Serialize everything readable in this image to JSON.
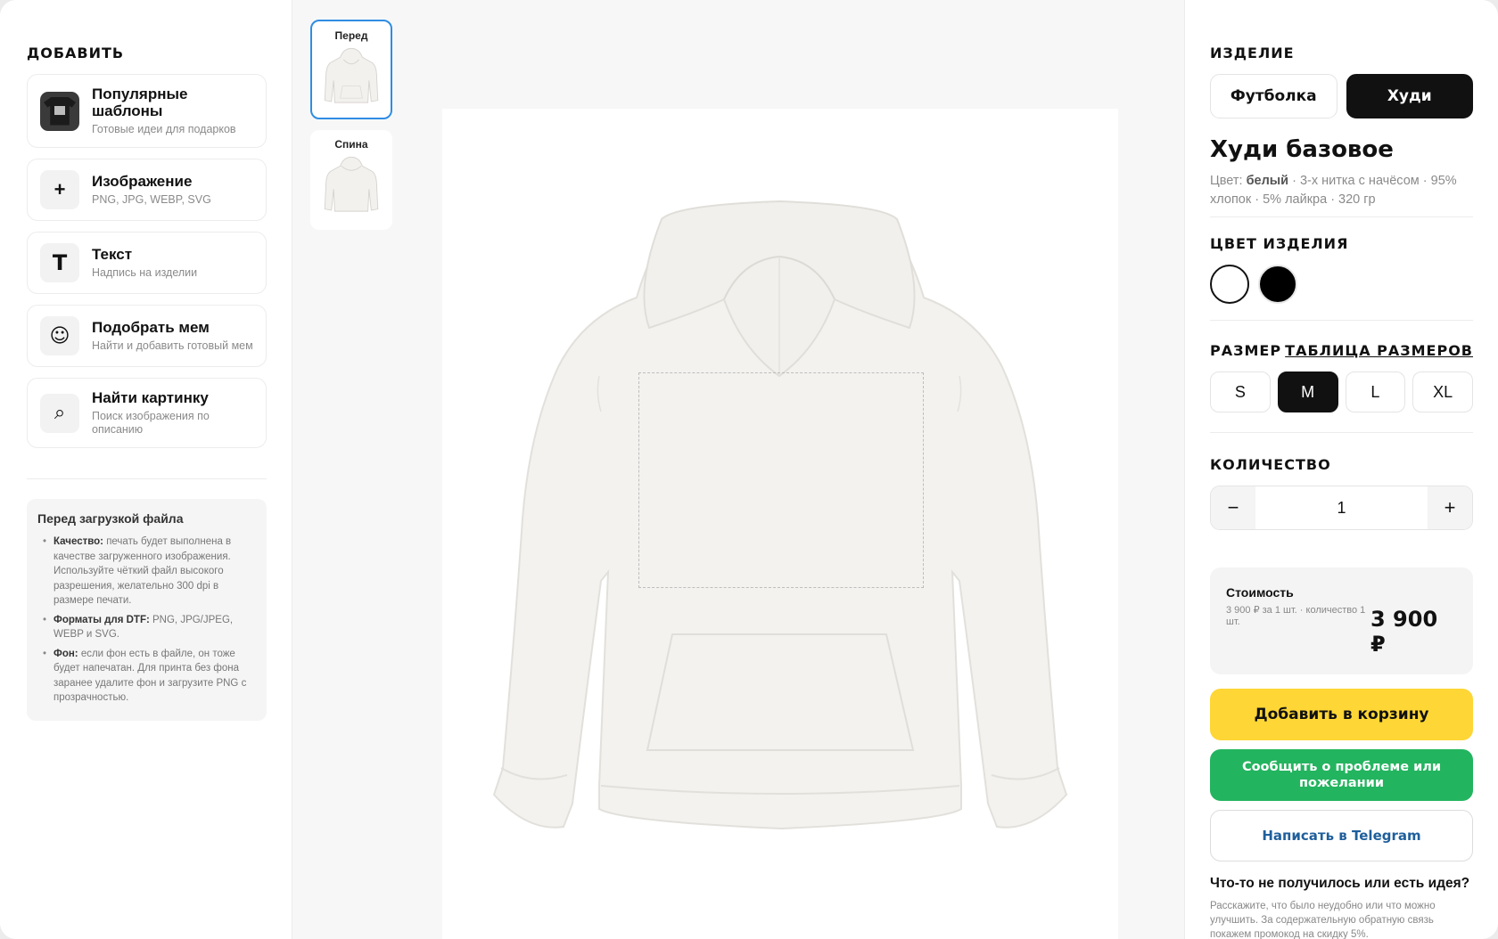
{
  "left": {
    "title": "ДОБАВИТЬ",
    "tools": [
      {
        "title": "Популярные шаблоны",
        "subtitle": "Готовые идеи для подарков",
        "icon": "tshirt-thumbnail"
      },
      {
        "title": "Изображение",
        "subtitle": "PNG, JPG, WEBP, SVG",
        "icon": "plus-icon",
        "glyph": "+"
      },
      {
        "title": "Текст",
        "subtitle": "Надпись на изделии",
        "icon": "text-icon",
        "glyph": "T"
      },
      {
        "title": "Подобрать мем",
        "subtitle": "Найти и добавить готовый мем",
        "icon": "smiley-icon",
        "glyph": "☺"
      },
      {
        "title": "Найти картинку",
        "subtitle": "Поиск изображения по описанию",
        "icon": "search-icon",
        "glyph": "⌕"
      }
    ],
    "info": {
      "title": "Перед загрузкой файла",
      "items": [
        {
          "label": "Качество:",
          "text": " печать будет выполнена в качестве загруженного изображения. Используйте чёткий файл высокого разрешения, желательно 300 dpi в размере печати."
        },
        {
          "label": "Форматы для DTF:",
          "text": " PNG, JPG/JPEG, WEBP и SVG."
        },
        {
          "label": "Фон:",
          "text": " если фон есть в файле, он тоже будет напечатан. Для принта без фона заранее удалите фон и загрузите PNG с прозрачностью."
        }
      ]
    }
  },
  "views": [
    {
      "label": "Перед",
      "active": true
    },
    {
      "label": "Спина",
      "active": false
    }
  ],
  "right": {
    "product_section": "ИЗДЕЛИЕ",
    "product_types": [
      {
        "label": "Футболка",
        "active": false
      },
      {
        "label": "Худи",
        "active": true
      }
    ],
    "product_title": "Худи базовое",
    "desc_color_label": "Цвет: ",
    "desc_color_value": "белый",
    "desc_rest": " · 3-х нитка с начёсом · 95% хлопок · 5% лайкра · 320 гр",
    "color_section": "ЦВЕТ ИЗДЕЛИЯ",
    "colors": [
      {
        "name": "white",
        "hex": "#ffffff",
        "selected": true
      },
      {
        "name": "black",
        "hex": "#000000",
        "selected": false
      }
    ],
    "size_section": "РАЗМЕР",
    "size_table_link": "ТАБЛИЦА РАЗМЕРОВ",
    "sizes": [
      {
        "label": "S",
        "active": false
      },
      {
        "label": "M",
        "active": true
      },
      {
        "label": "L",
        "active": false
      },
      {
        "label": "XL",
        "active": false
      }
    ],
    "qty_section": "КОЛИЧЕСТВО",
    "qty_minus": "−",
    "qty_value": "1",
    "qty_plus": "+",
    "price_label": "Стоимость",
    "price_detail": "3 900 ₽ за 1 шт. · количество 1 шт.",
    "price_value": "3 900 ₽",
    "cart_button": "Добавить в корзину",
    "feedback_button": "Сообщить о проблеме или пожелании",
    "telegram_button": "Написать в Telegram",
    "idea_title": "Что-то не получилось или есть идея?",
    "idea_text": "Расскажите, что было неудобно или что можно улучшить. За содержательную обратную связь покажем промокод на скидку 5%."
  },
  "colors": {
    "accent_yellow": "#fed635",
    "accent_green": "#23b45f",
    "active_view_border": "#2f8de4",
    "telegram_text": "#1f5f9c"
  }
}
